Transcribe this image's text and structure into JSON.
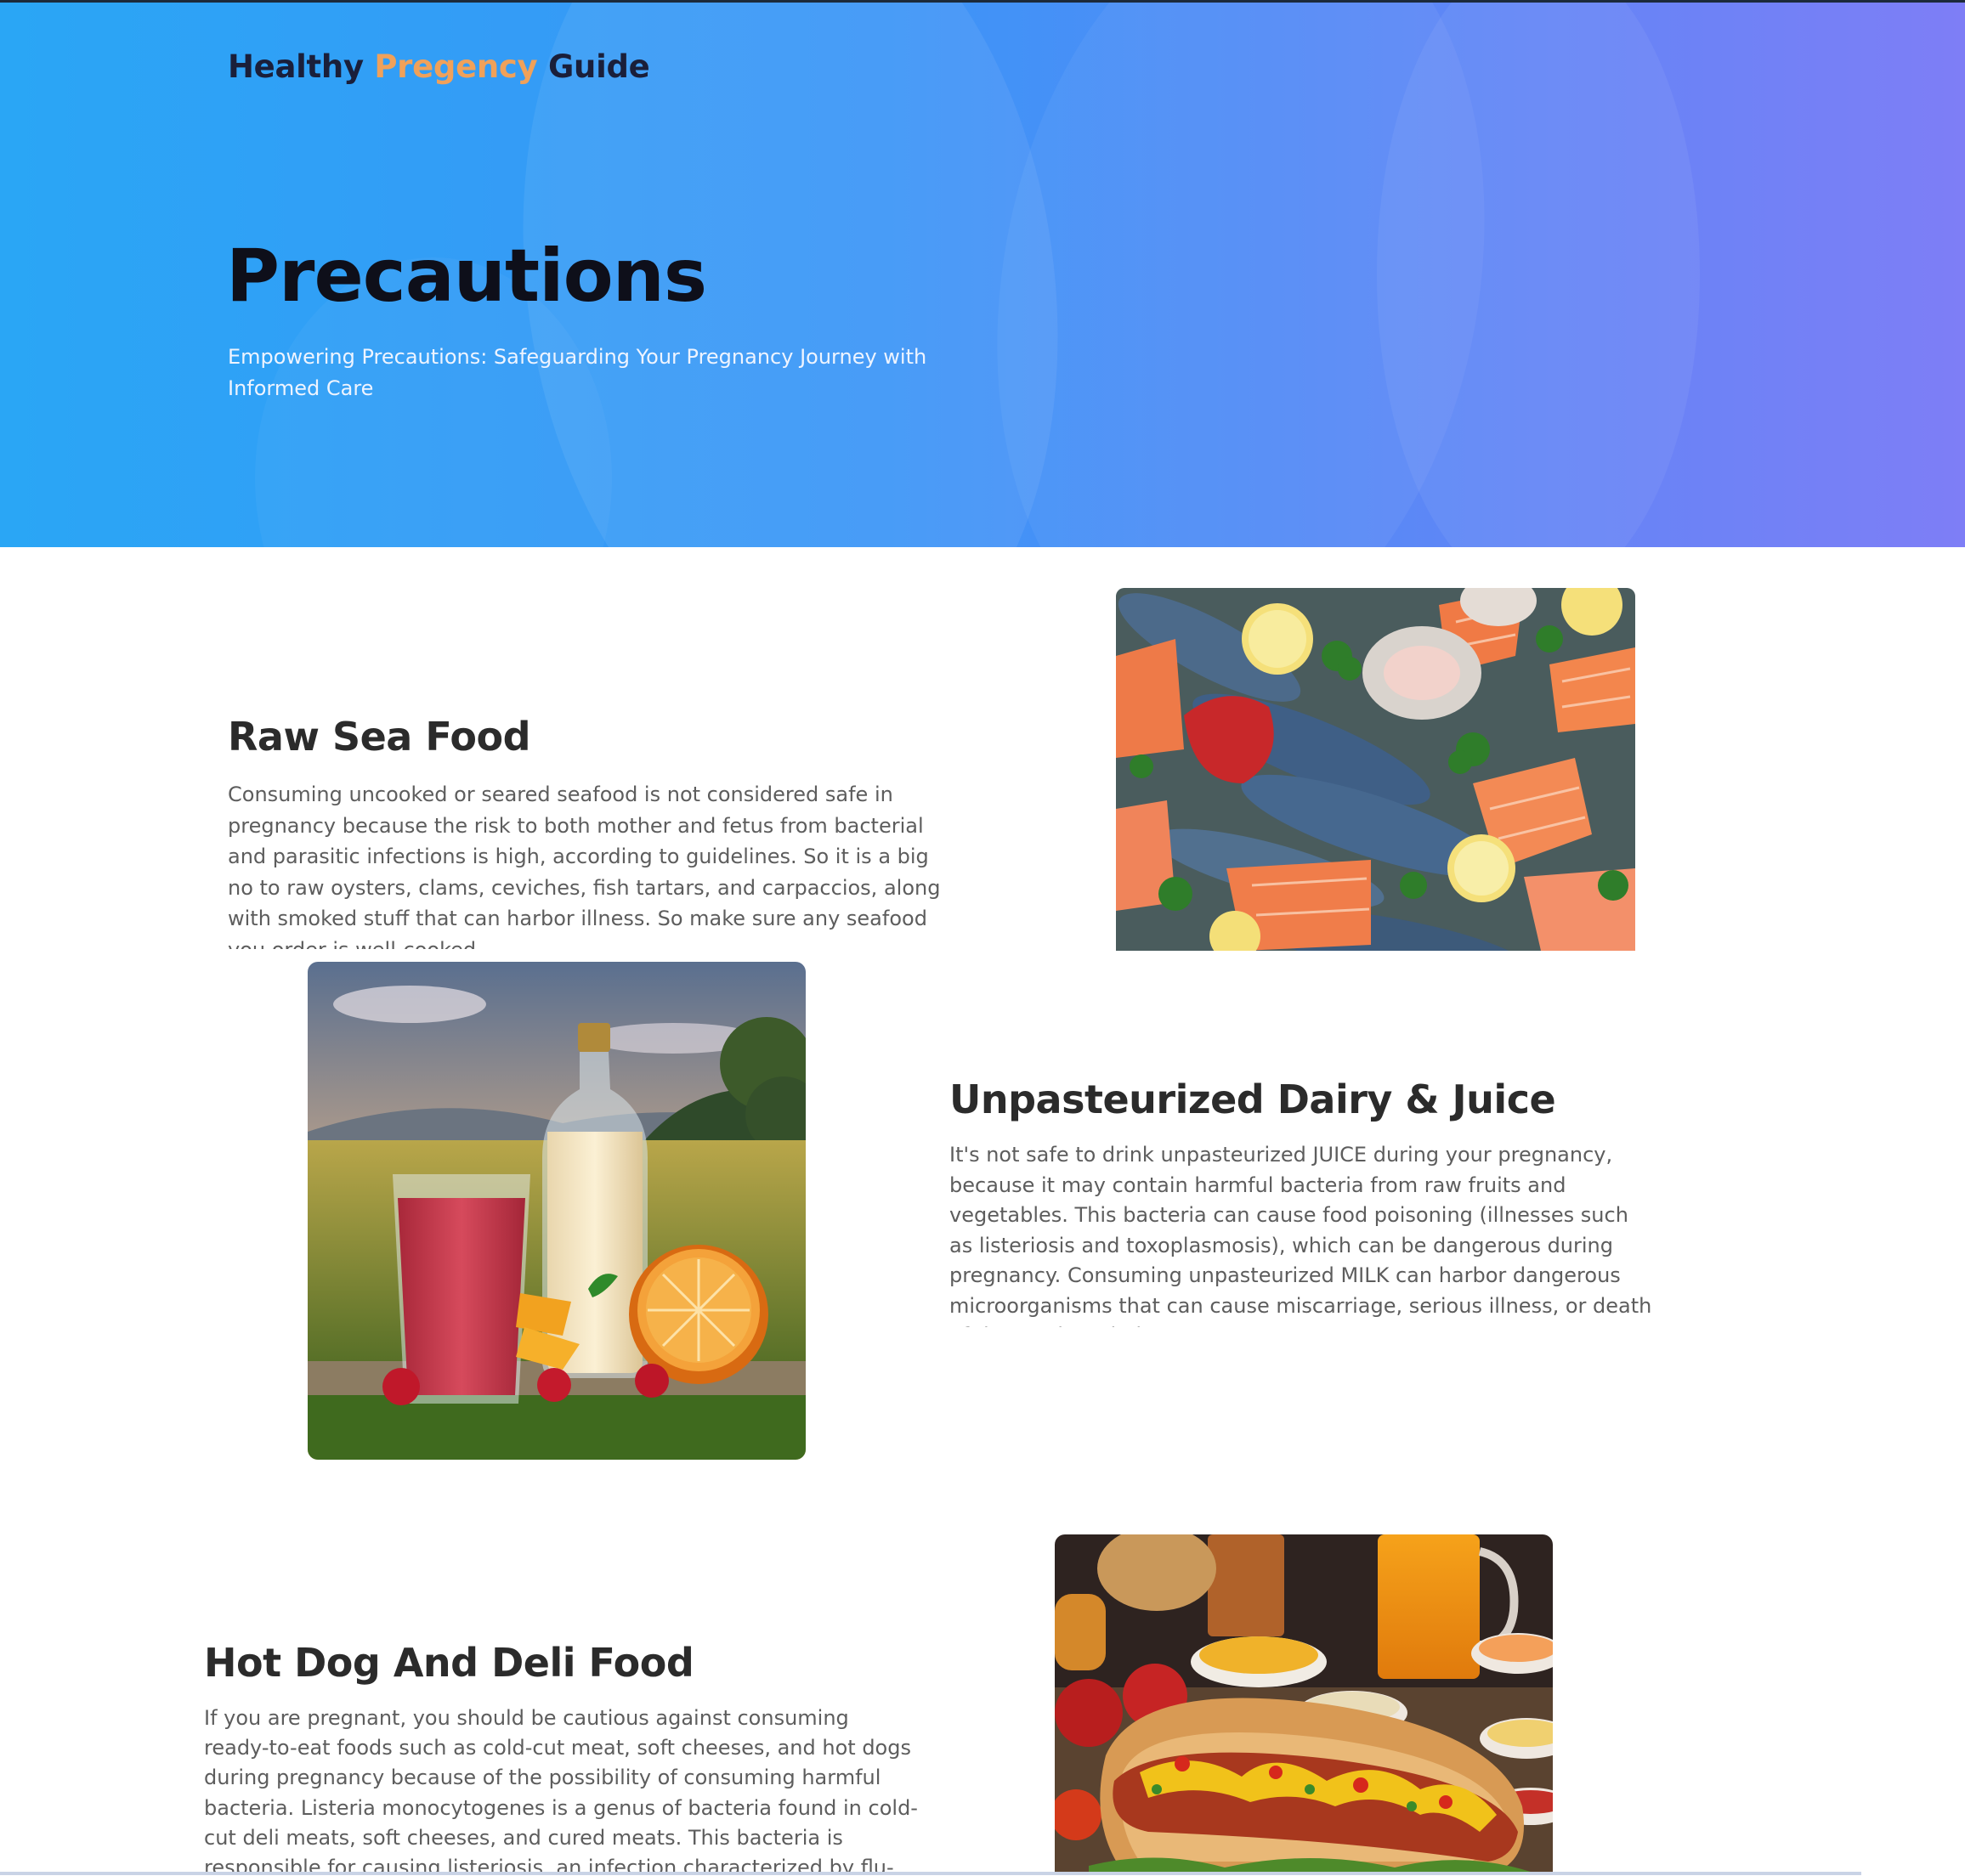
{
  "header": {
    "brand_part1": "Healthy ",
    "brand_accent": "Pregency",
    "brand_part2": " Guide",
    "title": "Precautions",
    "subtitle": "Empowering Precautions: Safeguarding Your Pregnancy Journey with Informed Care"
  },
  "sections": [
    {
      "title": "Raw Sea Food",
      "text": "Consuming uncooked or seared seafood is not considered safe in pregnancy because the risk to both mother and fetus from bacterial and parasitic infections is high, according to guidelines. So it is a big no to raw oysters, clams, ceviches, fish tartars, and carpaccios, along with smoked stuff that can harbor illness. So make sure any seafood you order is well-cooked."
    },
    {
      "title": "Unpasteurized Dairy & Juice",
      "text": "It's not safe to drink unpasteurized JUICE during your pregnancy, because it may contain harmful bacteria from raw fruits and vegetables. This bacteria can cause food poisoning (illnesses such as listeriosis and toxoplasmosis), which can be dangerous during pregnancy. Consuming unpasteurized MILK can harbor dangerous microorganisms that can cause miscarriage, serious illness, or death of the newborn baby."
    },
    {
      "title": "Hot Dog And Deli Food",
      "text": "If you are pregnant, you should be cautious against consuming ready-to-eat foods such as cold-cut meat, soft cheeses, and hot dogs during pregnancy because of the possibility of consuming harmful bacteria. Listeria monocytogenes is a genus of bacteria found in cold-cut deli meats, soft cheeses, and cured meats. This bacteria is responsible for causing listeriosis, an infection characterized by flu-like symptoms and"
    }
  ]
}
